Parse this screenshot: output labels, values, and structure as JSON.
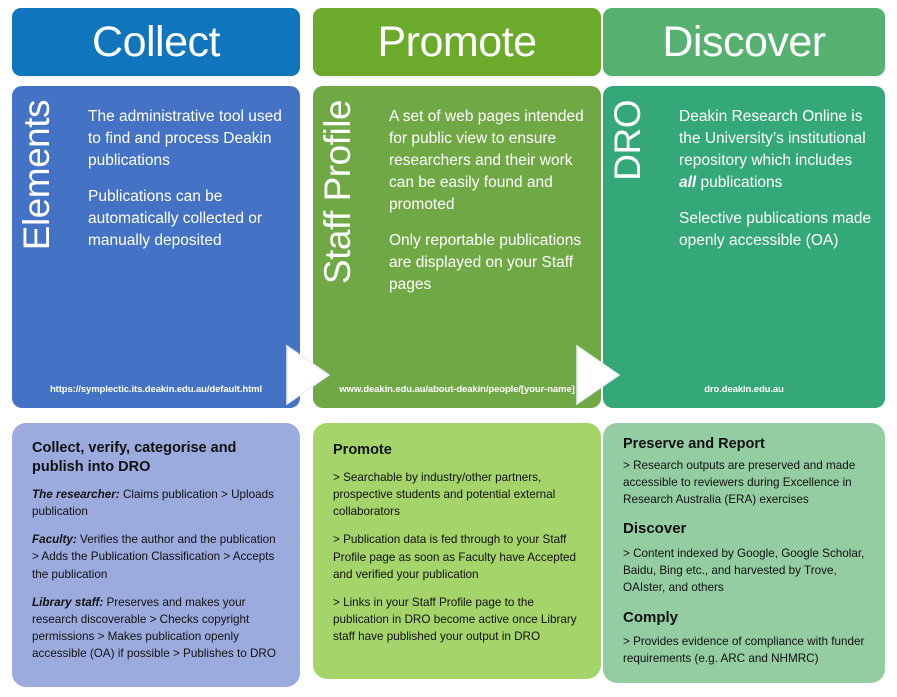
{
  "columns": [
    {
      "key": "collect",
      "header": "Collect",
      "header_color": "#0f75bc",
      "panel_color": "#4472c4",
      "vertical_label": "Elements",
      "paragraphs": [
        "The administrative tool used to find and process Deakin publications",
        "Publications can be automatically collected or manually deposited"
      ],
      "url": "https://symplectic.its.deakin.edu.au/default.html",
      "card": {
        "color": "#9cabde",
        "title": "Collect, verify, categorise and publish into DRO",
        "items": [
          {
            "lead": "The researcher:",
            "text": " Claims publication > Uploads publication"
          },
          {
            "lead": "Faculty:",
            "text": " Verifies the author and the publication > Adds the Publication Classification > Accepts the publication"
          },
          {
            "lead": "Library staff:",
            "text": " Preserves and makes your research discoverable > Checks copyright permissions > Makes publication openly accessible (OA) if possible > Publishes to DRO"
          }
        ]
      }
    },
    {
      "key": "promote",
      "header": "Promote",
      "header_color": "#6caa2b",
      "panel_color": "#6fa845",
      "vertical_label": "Staff Profile",
      "paragraphs": [
        "A set of web pages intended for public view to ensure researchers and their work can be easily found and promoted",
        "Only reportable publications are displayed on your Staff pages"
      ],
      "url": "www.deakin.edu.au/about-deakin/people/[your-name]",
      "card": {
        "color": "#a5d46a",
        "title": "Promote",
        "items": [
          {
            "lead": "",
            "text": "> Searchable by industry/other partners, prospective students and potential external collaborators"
          },
          {
            "lead": "",
            "text": "> Publication data is fed through to your Staff Profile page as soon as Faculty have Accepted and verified your publication"
          },
          {
            "lead": "",
            "text": "> Links in your Staff Profile page to the publication in DRO become active once Library staff have published your output in DRO"
          }
        ]
      }
    },
    {
      "key": "discover",
      "header": "Discover",
      "header_color": "#56b070",
      "panel_color": "#34a878",
      "vertical_label": "DRO",
      "paragraphs_rich": [
        {
          "before": "Deakin Research Online is the University’s institutional repository which includes ",
          "emphasis": "all",
          "after": " publications"
        },
        {
          "before": "Selective publications made openly accessible (OA)",
          "emphasis": "",
          "after": ""
        }
      ],
      "url": "dro.deakin.edu.au",
      "card": {
        "color": "#95cda2",
        "sections": [
          {
            "title": "Preserve and Report",
            "text": "> Research outputs are preserved and made accessible to reviewers during Excellence in Research Australia (ERA) exercises"
          },
          {
            "title": "Discover",
            "text": "> Content indexed by Google, Google Scholar, Baidu, Bing etc., and harvested by Trove, OAIster, and others"
          },
          {
            "title": "Comply",
            "text": "> Provides evidence of compliance with funder requirements (e.g. ARC and NHMRC)"
          }
        ]
      }
    }
  ],
  "connectors": [
    {
      "name": "chevron-collect-to-promote",
      "direction": "right",
      "color": "#ffffff"
    },
    {
      "name": "chevron-promote-to-discover",
      "direction": "right",
      "color": "#ffffff"
    }
  ]
}
